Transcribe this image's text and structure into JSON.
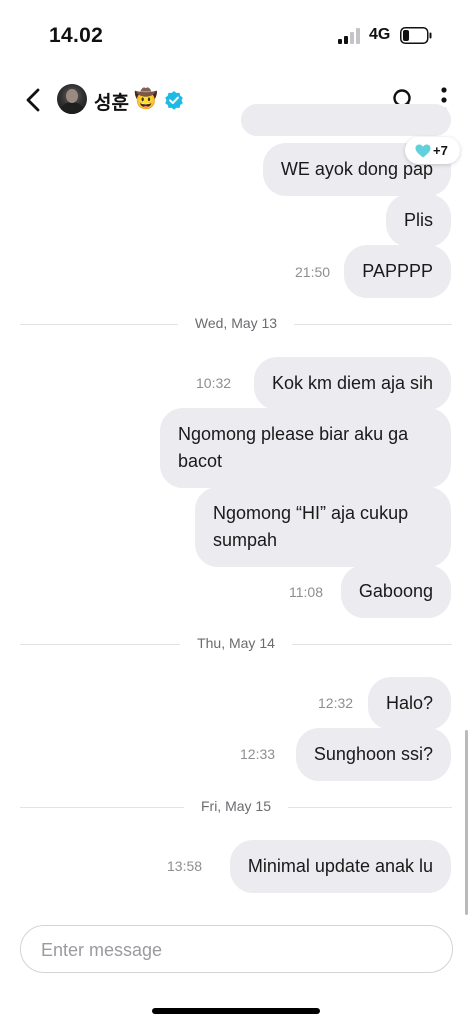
{
  "status_bar": {
    "time": "14.02",
    "network": "4G"
  },
  "header": {
    "contact_name": "성훈",
    "name_emoji": "🤠",
    "verified_color": "#1fb9e6"
  },
  "reaction": {
    "count": "+7",
    "heart_color": "#5fd0dc"
  },
  "messages": [
    {
      "text": "",
      "time": ""
    },
    {
      "text": "WE ayok dong pap",
      "time": ""
    },
    {
      "text": "Plis",
      "time": ""
    },
    {
      "text": "PAPPPP",
      "time": "21:50"
    },
    {
      "text": "Kok km diem aja sih",
      "time": "10:32"
    },
    {
      "text": "Ngomong please biar aku ga bacot",
      "time": ""
    },
    {
      "text": "Ngomong “HI” aja cukup sumpah",
      "time": ""
    },
    {
      "text": "Gaboong",
      "time": "11:08"
    },
    {
      "text": "Halo?",
      "time": "12:32"
    },
    {
      "text": "Sunghoon ssi?",
      "time": "12:33"
    },
    {
      "text": "Minimal update anak lu",
      "time": "13:58"
    }
  ],
  "date_dividers": [
    "Wed, May 13",
    "Thu, May 14",
    "Fri, May 15"
  ],
  "composer": {
    "placeholder": "Enter message"
  }
}
